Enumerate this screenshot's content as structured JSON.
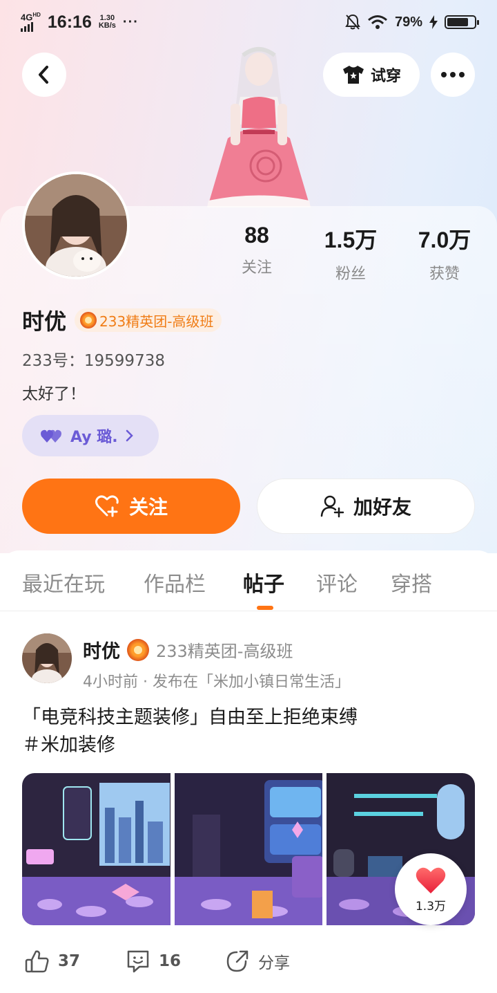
{
  "status_bar": {
    "network": "4G",
    "network_sup": "HD",
    "time": "16:16",
    "speed_value": "1.30",
    "speed_unit": "KB/s",
    "more": "···",
    "battery_pct": "79%",
    "battery_level": 0.79
  },
  "header": {
    "tryon_label": "试穿"
  },
  "profile": {
    "stats": [
      {
        "value": "88",
        "label": "关注"
      },
      {
        "value": "1.5万",
        "label": "粉丝"
      },
      {
        "value": "7.0万",
        "label": "获赞"
      }
    ],
    "name": "时优",
    "badge": "233精英团-高级班",
    "uid": "233号：19599738",
    "bio": "太好了！",
    "guild_pill": "Ay 璐."
  },
  "actions": {
    "follow_label": "关注",
    "add_friend_label": "加好友"
  },
  "tabs": [
    {
      "label": "最近在玩",
      "active": false
    },
    {
      "label": "作品栏",
      "active": false
    },
    {
      "label": "帖子",
      "active": true
    },
    {
      "label": "评论",
      "active": false
    },
    {
      "label": "穿搭",
      "active": false
    }
  ],
  "post": {
    "author": "时优",
    "badge": "233精英团-高级班",
    "meta": "4小时前 · 发布在「米加小镇日常生活」",
    "text_line1": "「电竞科技主题装修」自由至上拒绝束缚",
    "text_line2": "＃米加装修",
    "like_bubble_count": "1.3万",
    "likes": "37",
    "comments": "16",
    "share_label": "分享"
  }
}
